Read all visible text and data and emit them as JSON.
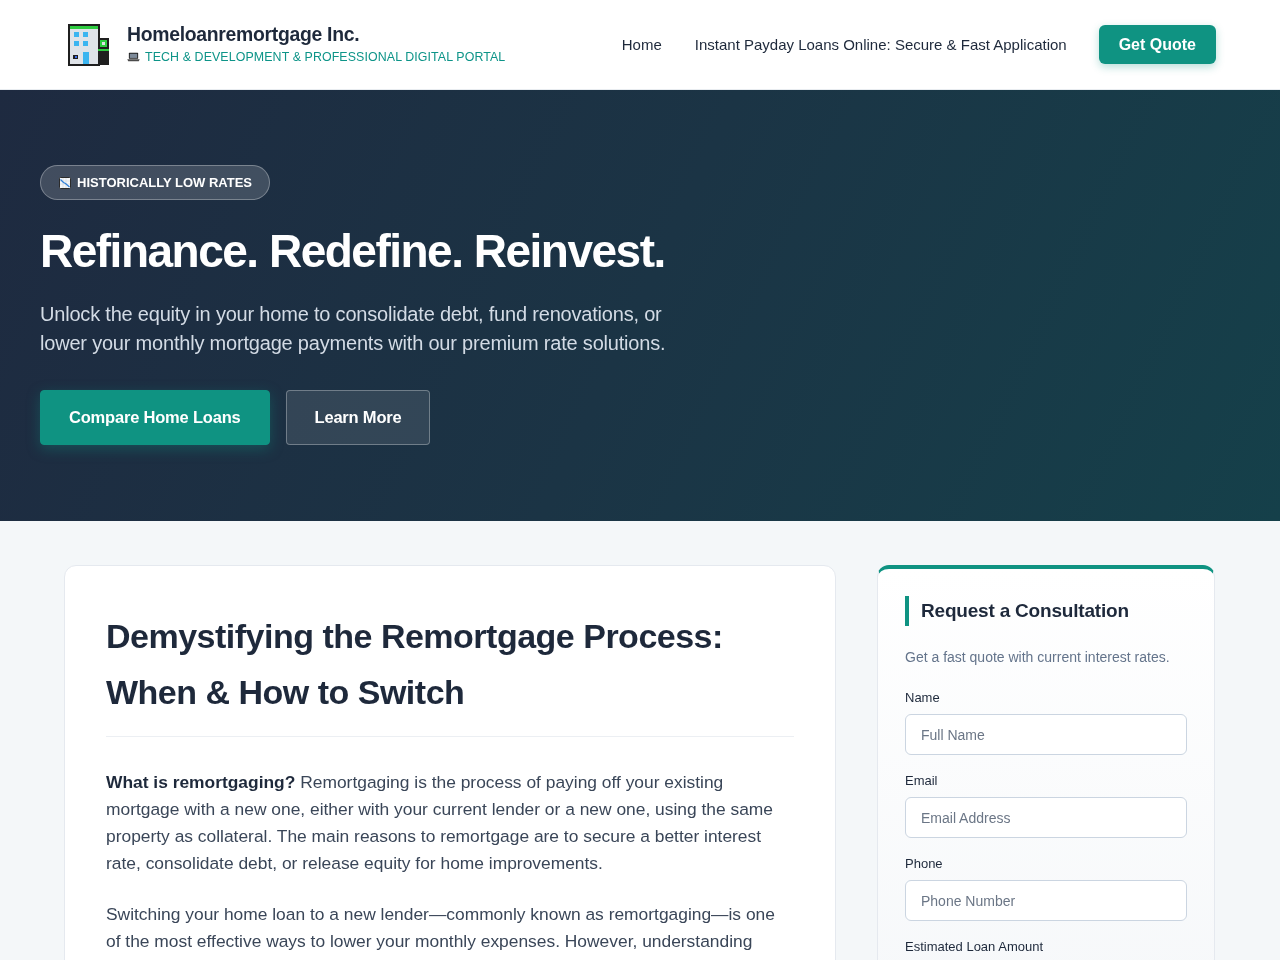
{
  "header": {
    "brand": {
      "name": "Homeloanremortgage Inc.",
      "tagline": "TECH & DEVELOPMENT & PROFESSIONAL DIGITAL PORTAL"
    },
    "nav": [
      {
        "label": "Home"
      },
      {
        "label": "Instant Payday Loans Online: Secure & Fast Application"
      }
    ],
    "cta": "Get Quote"
  },
  "hero": {
    "badge": "HISTORICALLY LOW RATES",
    "title": "Refinance. Redefine. Reinvest.",
    "subtitle": "Unlock the equity in your home to consolidate debt, fund renovations, or lower your monthly mortgage payments with our premium rate solutions.",
    "buttons": [
      {
        "label": "Compare Home Loans",
        "kind": "primary"
      },
      {
        "label": "Learn More",
        "kind": "secondary"
      }
    ]
  },
  "article": {
    "title": "Demystifying the Remortgage Process: When & How to Switch",
    "paragraphs": [
      "**What is remortgaging?** Remortgaging is the process of paying off your existing mortgage with a new one, either with your current lender or a new one, using the same property as collateral. The main reasons to remortgage are to secure a better interest rate, consolidate debt, or release equity for home improvements.",
      "Switching your home loan to a new lender—commonly known as remortgaging—is one of the most effective ways to lower your monthly expenses. However, understanding"
    ]
  },
  "consultation_form": {
    "title": "Request a Consultation",
    "subtitle": "Get a fast quote with current interest rates.",
    "fields": [
      {
        "label": "Name",
        "placeholder": "Full Name"
      },
      {
        "label": "Email",
        "placeholder": "Email Address"
      },
      {
        "label": "Phone",
        "placeholder": "Phone Number"
      },
      {
        "label": "Estimated Loan Amount"
      }
    ]
  }
}
